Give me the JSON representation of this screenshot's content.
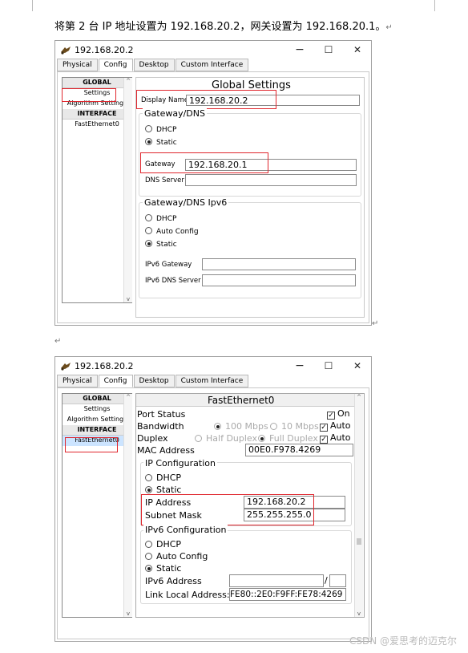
{
  "intro": {
    "text": "将第 2 台 IP 地址设置为 192.168.20.2，网关设置为 192.168.20.1。",
    "return_mark": "↵"
  },
  "icons": {
    "app_icon": "packet-tracer-device-icon",
    "minimize": "−",
    "maximize": "☐",
    "close": "✕",
    "scroll_up": "^",
    "scroll_down": "v",
    "return_mark": "↵"
  },
  "colors": {
    "highlight_box": "#e0262d",
    "selected_nav": "#cce4ff"
  },
  "win1": {
    "title": "192.168.20.2",
    "tabs": [
      "Physical",
      "Config",
      "Desktop",
      "Custom Interface"
    ],
    "active_tab": "Config",
    "nav": {
      "global": "GLOBAL",
      "settings": "Settings",
      "algorithm": "Algorithm Settings",
      "interface": "INTERFACE",
      "fastethernet": "FastEthernet0"
    },
    "panel_title": "Global Settings",
    "display_name_label": "Display Name",
    "display_name_value": "192.168.20.2",
    "gateway_group_title": "Gateway/DNS",
    "dhcp": "DHCP",
    "static": "Static",
    "gateway_label": "Gateway",
    "gateway_value": "192.168.20.1",
    "dns_label": "DNS Server",
    "dns_value": "",
    "ipv6_group_title": "Gateway/DNS Ipv6",
    "ipv6_dhcp": "DHCP",
    "ipv6_auto": "Auto Config",
    "ipv6_static": "Static",
    "ipv6_gateway_label": "IPv6 Gateway",
    "ipv6_gateway_value": "",
    "ipv6_dns_label": "IPv6 DNS Server",
    "ipv6_dns_value": ""
  },
  "win2": {
    "title": "192.168.20.2",
    "tabs": [
      "Physical",
      "Config",
      "Desktop",
      "Custom Interface"
    ],
    "active_tab": "Config",
    "nav": {
      "global": "GLOBAL",
      "settings": "Settings",
      "algorithm": "Algorithm Settings",
      "interface": "INTERFACE",
      "fastethernet": "FastEthernet0"
    },
    "panel_title": "FastEthernet0",
    "port_status_label": "Port Status",
    "port_on": "On",
    "bandwidth_label": "Bandwidth",
    "bw_100": "100 Mbps",
    "bw_10": "10 Mbps",
    "bw_auto": "Auto",
    "duplex_label": "Duplex",
    "half": "Half Duplex",
    "full": "Full Duplex",
    "duplex_auto": "Auto",
    "mac_label": "MAC Address",
    "mac_value": "00E0.F978.4269",
    "ipconf_title": "IP Configuration",
    "dhcp": "DHCP",
    "static": "Static",
    "ip_label": "IP Address",
    "ip_value": "192.168.20.2",
    "mask_label": "Subnet Mask",
    "mask_value": "255.255.255.0",
    "ipv6conf_title": "IPv6 Configuration",
    "ipv6_dhcp": "DHCP",
    "ipv6_auto": "Auto Config",
    "ipv6_static": "Static",
    "ipv6_addr_label": "IPv6 Address",
    "ipv6_addr_value": "",
    "ipv6_prefix_sep": "/",
    "ipv6_prefix_value": "",
    "link_local_label": "Link Local Address:",
    "link_local_value": "FE80::2E0:F9FF:FE78:4269"
  },
  "watermark": "CSDN @爱思考的迈克尔"
}
